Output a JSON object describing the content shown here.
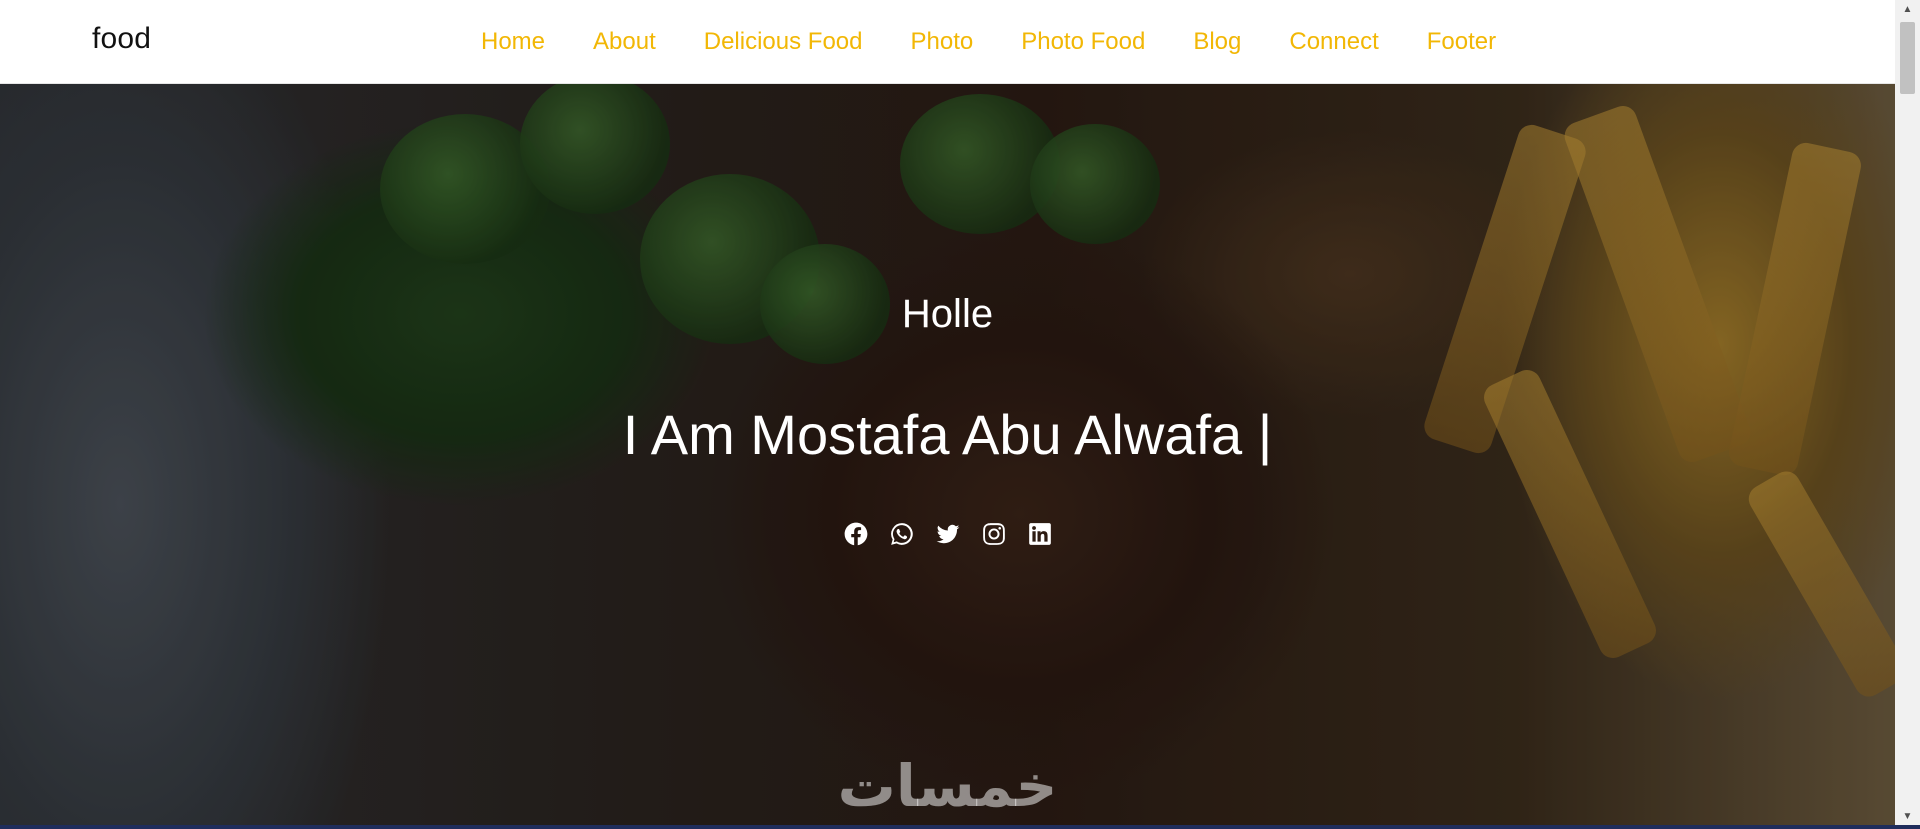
{
  "brand": "food",
  "nav": {
    "items": [
      {
        "label": "Home"
      },
      {
        "label": "About"
      },
      {
        "label": "Delicious Food"
      },
      {
        "label": "Photo"
      },
      {
        "label": "Photo Food"
      },
      {
        "label": "Blog"
      },
      {
        "label": "Connect"
      },
      {
        "label": "Footer"
      }
    ]
  },
  "hero": {
    "greeting": "Holle",
    "headline": "I Am Mostafa Abu Alwafa |",
    "social_icons": [
      "facebook-icon",
      "whatsapp-icon",
      "twitter-icon",
      "instagram-icon",
      "linkedin-icon"
    ]
  },
  "watermark": "خمسات",
  "colors": {
    "nav_link": "#f2b705",
    "brand": "#111111",
    "hero_text": "#ffffff"
  }
}
